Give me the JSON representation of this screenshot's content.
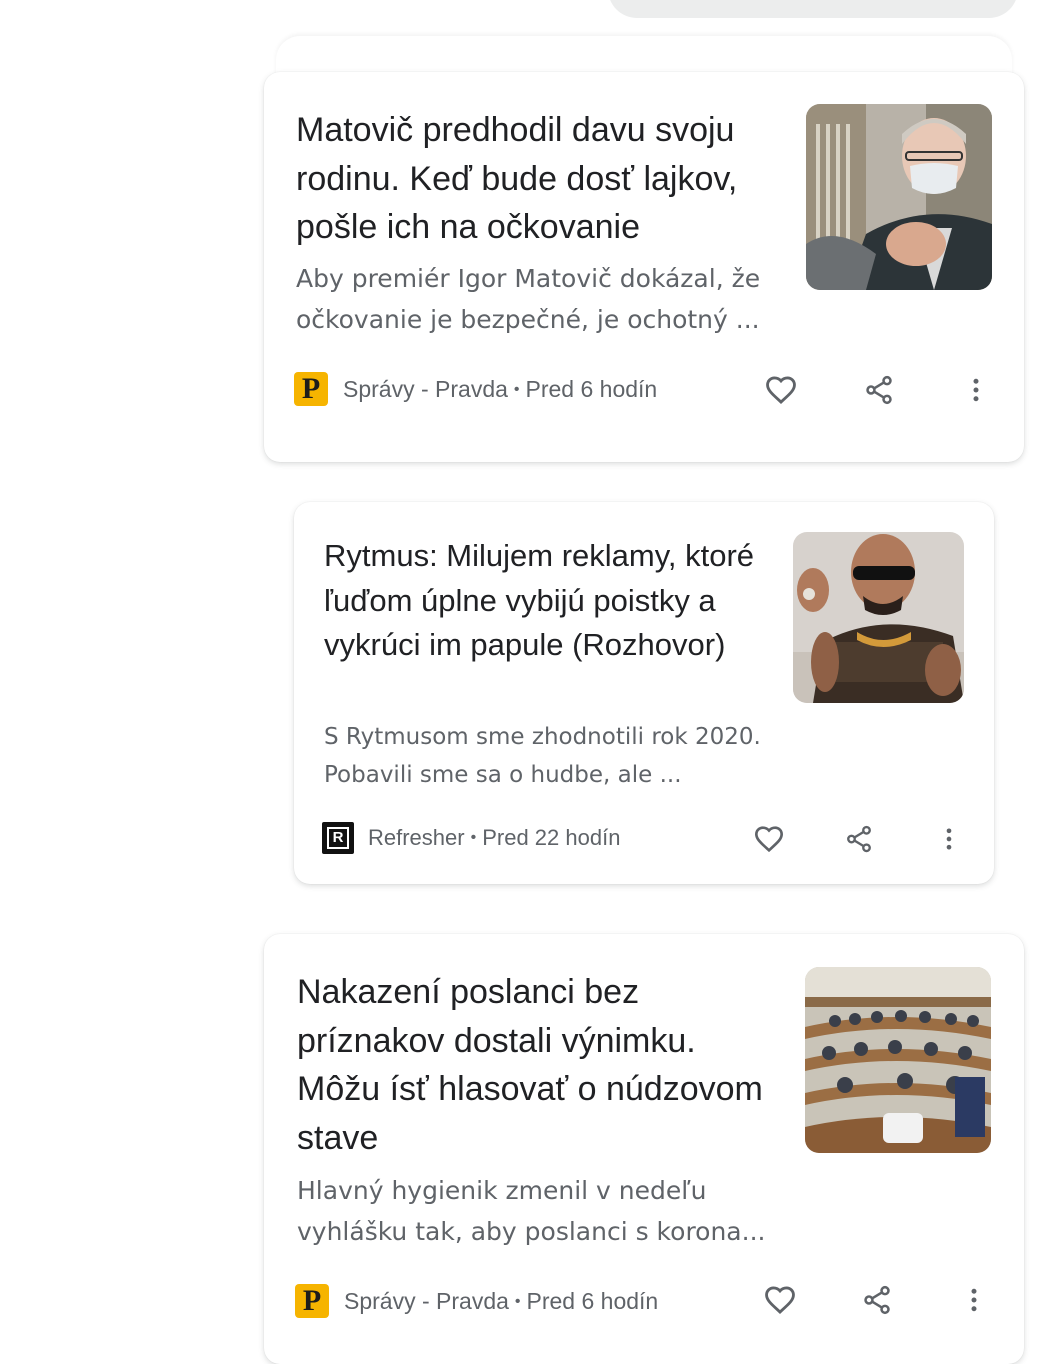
{
  "feed": {
    "cards": [
      {
        "headline": "Matovič predhodil davu svoju rodinu. Keď bude dosť lajkov, pošle ich na očkovanie",
        "snippet": "Aby premiér Igor Matovič dokázal, že očkovanie je bezpečné, je ochotný ...",
        "source_logo": "P",
        "source": "Správy - Pravda",
        "separator": "•",
        "time": "Pred 6 hodín",
        "thumbnail_icon": "photo-man-with-face-mask"
      },
      {
        "headline": "Rytmus: Milujem reklamy, ktoré ľuďom úplne vybijú poistky a vykrúci im papule (Rozhovor)",
        "snippet": "S Rytmusom sme zhodnotili rok 2020. Pobavili sme sa o hudbe, ale ...",
        "source_logo": "R",
        "source": "Refresher",
        "separator": "•",
        "time": "Pred 22 hodín",
        "thumbnail_icon": "photo-man-with-sunglasses"
      },
      {
        "headline": "Nakazení poslanci bez príznakov dostali výnimku. Môžu ísť hlasovať o núdzovom stave",
        "snippet": "Hlavný hygienik zmenil v nedeľu vyhlášku tak, aby poslanci s korona...",
        "source_logo": "P",
        "source": "Správy - Pravda",
        "separator": "•",
        "time": "Pred 6 hodín",
        "thumbnail_icon": "photo-parliament-hall"
      }
    ]
  },
  "actions": {
    "like_icon": "heart-icon",
    "share_icon": "share-icon",
    "more_icon": "more-vert-icon"
  },
  "colors": {
    "headline": "#202124",
    "secondary_text": "#5f6368",
    "pravda_logo_bg": "#f6b400",
    "refresher_logo_bg": "#111111",
    "icon": "#5f6368"
  }
}
